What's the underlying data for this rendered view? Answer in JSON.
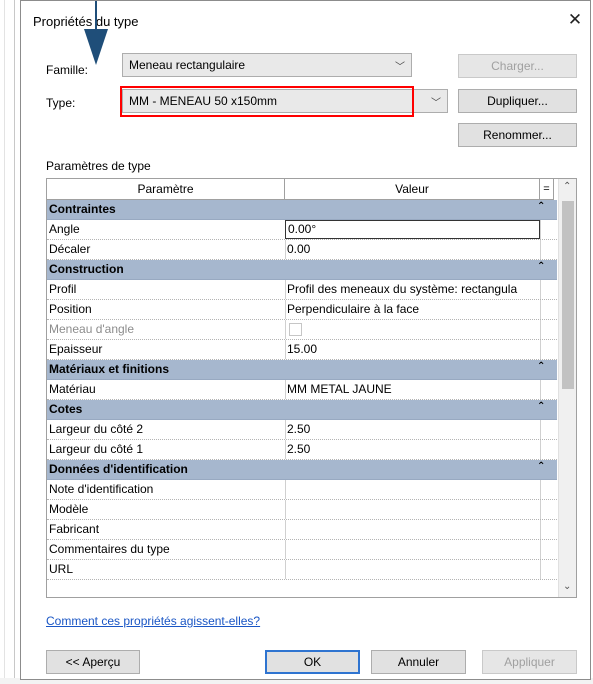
{
  "dialog": {
    "title": "Propriétés du type",
    "close_glyph": "✕"
  },
  "fields": {
    "family_label": "Famille:",
    "family_value": "Meneau rectangulaire",
    "type_label": "Type:",
    "type_value": "MM  - MENEAU 50 x150mm",
    "combo_glyph": "﹀"
  },
  "buttons": {
    "load": "Charger...",
    "duplicate": "Dupliquer...",
    "rename": "Renommer...",
    "preview": "<< Aperçu",
    "ok": "OK",
    "cancel": "Annuler",
    "apply": "Appliquer"
  },
  "section_label": "Paramètres de type",
  "table": {
    "header_param": "Paramètre",
    "header_value": "Valeur",
    "header_eq": "=",
    "collapse_glyph": "⌃",
    "groups": [
      {
        "title": "Contraintes",
        "rows": [
          {
            "param": "Angle",
            "value": "0.00°"
          },
          {
            "param": "Décaler",
            "value": "0.00"
          }
        ]
      },
      {
        "title": "Construction",
        "rows": [
          {
            "param": "Profil",
            "value": "Profil des meneaux du système: rectangula"
          },
          {
            "param": "Position",
            "value": "Perpendiculaire à la face"
          },
          {
            "param": "Meneau d'angle",
            "value": ""
          },
          {
            "param": "Epaisseur",
            "value": "15.00"
          }
        ]
      },
      {
        "title": "Matériaux et finitions",
        "rows": [
          {
            "param": "Matériau",
            "value": "MM METAL JAUNE"
          }
        ]
      },
      {
        "title": "Cotes",
        "rows": [
          {
            "param": "Largeur du côté 2",
            "value": "2.50"
          },
          {
            "param": "Largeur du côté 1",
            "value": "2.50"
          }
        ]
      },
      {
        "title": "Données d'identification",
        "rows": [
          {
            "param": "Note d'identification",
            "value": ""
          },
          {
            "param": "Modèle",
            "value": ""
          },
          {
            "param": "Fabricant",
            "value": ""
          },
          {
            "param": "Commentaires du type",
            "value": ""
          },
          {
            "param": "URL",
            "value": ""
          }
        ]
      }
    ]
  },
  "help_link": "Comment ces propriétés agissent-elles?",
  "scroll_glyphs": {
    "up": "⌃",
    "down": "⌄"
  },
  "colors": {
    "group_header": "#a6b7ce",
    "highlight": "#ff0000",
    "link": "#1a56c5",
    "arrow": "#1f4e79"
  }
}
